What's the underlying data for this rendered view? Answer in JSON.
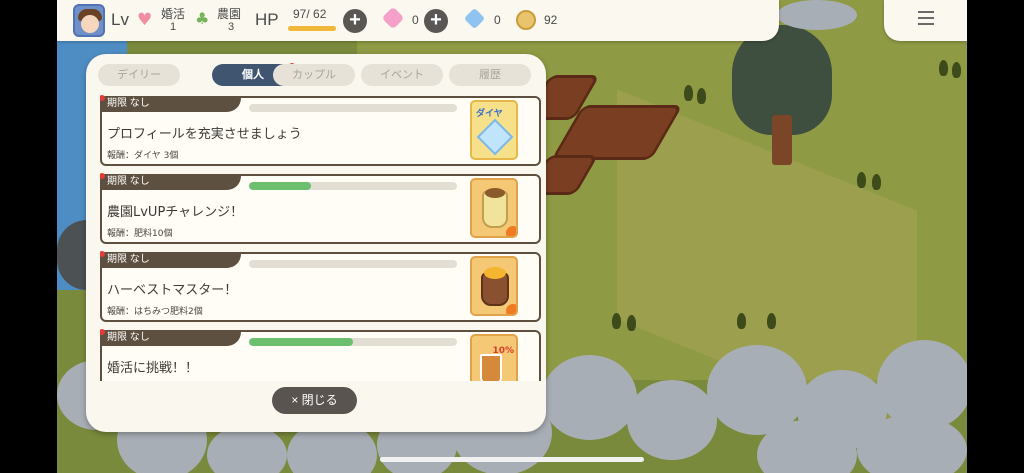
{
  "hud": {
    "lv_label": "Lv",
    "marriage": {
      "label": "婚活",
      "count": "1"
    },
    "farm": {
      "label": "農園",
      "count": "3"
    },
    "hp": {
      "label": "HP",
      "value": "97/ 62",
      "fill": 1.0
    },
    "pink_gems": "0",
    "blue_gems": "0",
    "coins": "92"
  },
  "tabs": [
    {
      "label": "デイリー",
      "active": false
    },
    {
      "label": "個人",
      "active": true
    },
    {
      "label": "カップル",
      "active": false
    },
    {
      "label": "イベント",
      "active": false
    },
    {
      "label": "履歴",
      "active": false
    }
  ],
  "missions": [
    {
      "deadline": "期限 なし",
      "title": "プロフィールを充実させましょう",
      "reward": "報酬：ダイヤ 3個",
      "progress": 0.0,
      "icon": "diamond-icon",
      "icon_text": "ダイヤ"
    },
    {
      "deadline": "期限 なし",
      "title": "農園LvUPチャレンジ！",
      "reward": "報酬：肥料10個",
      "progress": 0.3,
      "icon": "fertilizer-bag-icon"
    },
    {
      "deadline": "期限 なし",
      "title": "ハーベストマスター！",
      "reward": "報酬：はちみつ肥料2個",
      "progress": 0.0,
      "icon": "honey-fertilizer-icon"
    },
    {
      "deadline": "期限 なし",
      "title": "婚活に挑戦！！",
      "reward": "",
      "progress": 0.5,
      "icon": "drink-icon",
      "icon_text": "10%"
    }
  ],
  "close_button": {
    "label": "× 閉じる"
  },
  "colors": {
    "active_tab": "#3f5570",
    "progress_fill": "#6cbf6f",
    "badge": "#e43b35"
  }
}
